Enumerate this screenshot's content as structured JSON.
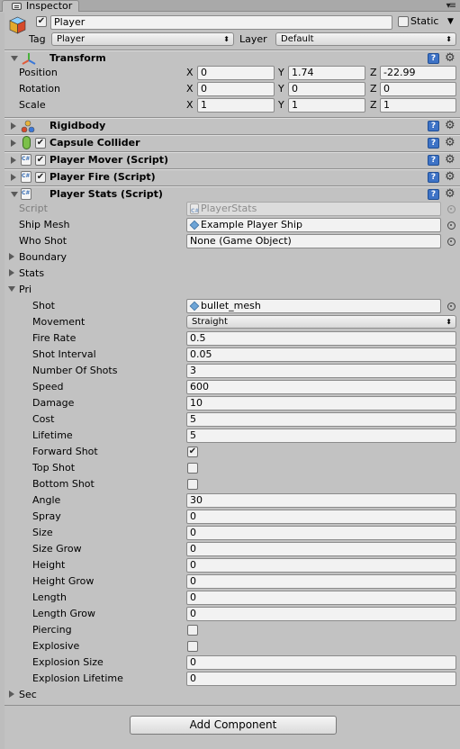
{
  "tab": {
    "title": "Inspector"
  },
  "gameobject": {
    "active": true,
    "name": "Player",
    "static_label": "Static",
    "tag_label": "Tag",
    "tag_value": "Player",
    "layer_label": "Layer",
    "layer_value": "Default"
  },
  "transform": {
    "title": "Transform",
    "rows": [
      {
        "label": "Position",
        "x": "0",
        "y": "1.74",
        "z": "-22.99"
      },
      {
        "label": "Rotation",
        "x": "0",
        "y": "0",
        "z": "0"
      },
      {
        "label": "Scale",
        "x": "1",
        "y": "1",
        "z": "1"
      }
    ],
    "axis": {
      "x": "X",
      "y": "Y",
      "z": "Z"
    }
  },
  "components": {
    "rigidbody": "Rigidbody",
    "capsule": "Capsule Collider",
    "mover": "Player Mover (Script)",
    "fire": "Player Fire (Script)",
    "stats": "Player Stats (Script)"
  },
  "stats": {
    "script_label": "Script",
    "script_value": "PlayerStats",
    "ship_mesh_label": "Ship Mesh",
    "ship_mesh_value": "Example Player Ship",
    "who_shot_label": "Who Shot",
    "who_shot_value": "None (Game Object)",
    "boundary_label": "Boundary",
    "stats_label": "Stats",
    "pri_label": "Pri",
    "sec_label": "Sec"
  },
  "pri": {
    "shot_label": "Shot",
    "shot_value": "bullet_mesh",
    "movement_label": "Movement",
    "movement_value": "Straight",
    "rows": [
      {
        "label": "Fire Rate",
        "value": "0.5"
      },
      {
        "label": "Shot Interval",
        "value": "0.05"
      },
      {
        "label": "Number Of Shots",
        "value": "3"
      },
      {
        "label": "Speed",
        "value": "600"
      },
      {
        "label": "Damage",
        "value": "10"
      },
      {
        "label": "Cost",
        "value": "5"
      },
      {
        "label": "Lifetime",
        "value": "5"
      }
    ],
    "checks": [
      {
        "label": "Forward Shot",
        "checked": true
      },
      {
        "label": "Top Shot",
        "checked": false
      },
      {
        "label": "Bottom Shot",
        "checked": false
      }
    ],
    "rows2": [
      {
        "label": "Angle",
        "value": "30"
      },
      {
        "label": "Spray",
        "value": "0"
      },
      {
        "label": "Size",
        "value": "0"
      },
      {
        "label": "Size Grow",
        "value": "0"
      },
      {
        "label": "Height",
        "value": "0"
      },
      {
        "label": "Height Grow",
        "value": "0"
      },
      {
        "label": "Length",
        "value": "0"
      },
      {
        "label": "Length Grow",
        "value": "0"
      }
    ],
    "checks2": [
      {
        "label": "Piercing",
        "checked": false
      },
      {
        "label": "Explosive",
        "checked": false
      }
    ],
    "rows3": [
      {
        "label": "Explosion Size",
        "value": "0"
      },
      {
        "label": "Explosion Lifetime",
        "value": "0"
      }
    ]
  },
  "add_component": "Add Component",
  "colors": {
    "panel": "#c2c2c2",
    "help": "#3e73c6",
    "field": "#f2f2f2"
  }
}
